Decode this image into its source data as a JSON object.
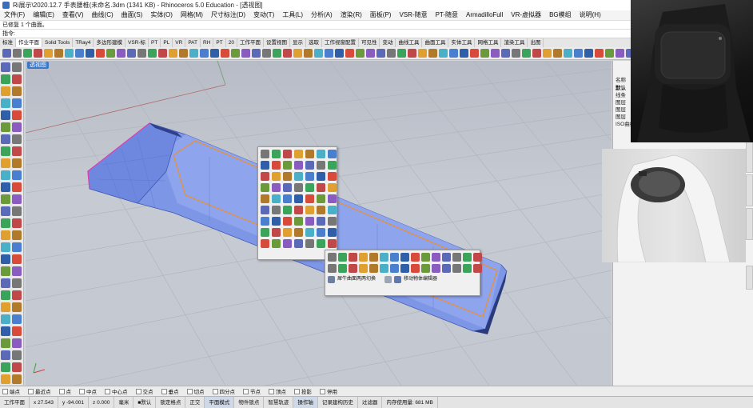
{
  "window": {
    "title": "Ri展示\\2020.12.7 手表腰椎(未命名.3dm (1341 KB) - Rhinoceros 5.0 Education - [透视图]"
  },
  "menu": {
    "items": [
      "文件(F)",
      "编辑(E)",
      "查看(V)",
      "曲线(C)",
      "曲面(S)",
      "实体(O)",
      "网格(M)",
      "尺寸标注(D)",
      "变动(T)",
      "工具(L)",
      "分析(A)",
      "渲染(R)",
      "面板(P)",
      "VSR-随意",
      "PT-随意",
      "ArmadilloFull",
      "VR-虚拟器",
      "BG模组",
      "说明(H)"
    ]
  },
  "command": {
    "history": "已修复 1 个曲面。",
    "prompt": "指令:"
  },
  "tabs": {
    "items": [
      "标准",
      "作业平面",
      "Solid Tools",
      "TRay4",
      "多边形建模",
      "VSR-标",
      "PT",
      "PL",
      "VR",
      "PAT",
      "RH",
      "PT",
      "20",
      "工作平面",
      "设置视图",
      "显示",
      "选取",
      "工作视窗配置",
      "可见性",
      "变动",
      "曲线工具",
      "曲面工具",
      "实体工具",
      "网格工具",
      "渲染工具",
      "出图"
    ],
    "active_index": 1
  },
  "viewport": {
    "label": "透视图"
  },
  "popup2": {
    "label_left": "犀牛曲面两两切换",
    "label_right": "移动物体编辑器"
  },
  "right_panel": {
    "labels": [
      "名称",
      "默认",
      "线条",
      "图层",
      "图层",
      "图层",
      "ISO曲线"
    ]
  },
  "osnap": {
    "items": [
      "端点",
      "最近点",
      "点",
      "中点",
      "中心点",
      "交点",
      "垂点",
      "切点",
      "四分点",
      "节点",
      "顶点",
      "投影",
      "停用"
    ]
  },
  "status": {
    "cells": [
      "工作平面",
      "x 27.543",
      "y -94.001",
      "z 0.000",
      "毫米",
      "■默认",
      "锁定格点",
      "正交",
      "平面模式",
      "物件锁点",
      "智慧轨迹",
      "操作轴",
      "记录建构历史",
      "过滤器",
      "内存使用量: 681 MB"
    ]
  }
}
